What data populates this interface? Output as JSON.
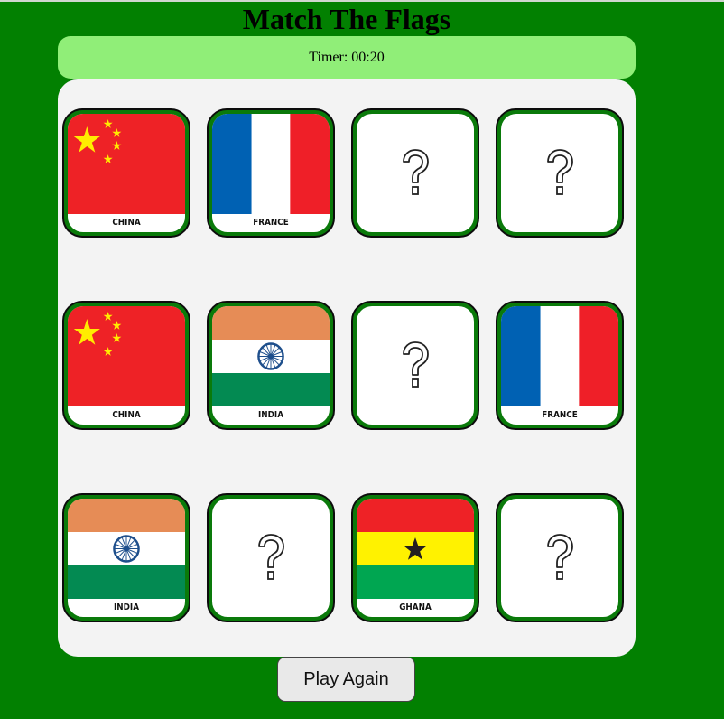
{
  "title": "Match The Flags",
  "timer": "Timer: 00:20",
  "play_again_label": "Play Again",
  "colors": {
    "background": "#028001",
    "timer_bar": "#90ee78",
    "board": "#f3f3f3",
    "card_border": "#0a7a0a"
  },
  "cards": [
    {
      "state": "revealed",
      "country": "CHINA",
      "flag": "china"
    },
    {
      "state": "revealed",
      "country": "FRANCE",
      "flag": "france"
    },
    {
      "state": "hidden",
      "icon": "question-mark-icon"
    },
    {
      "state": "hidden",
      "icon": "question-mark-icon"
    },
    {
      "state": "revealed",
      "country": "CHINA",
      "flag": "china"
    },
    {
      "state": "revealed",
      "country": "INDIA",
      "flag": "india"
    },
    {
      "state": "hidden",
      "icon": "question-mark-icon"
    },
    {
      "state": "revealed",
      "country": "FRANCE",
      "flag": "france"
    },
    {
      "state": "revealed",
      "country": "INDIA",
      "flag": "india"
    },
    {
      "state": "hidden",
      "icon": "question-mark-icon"
    },
    {
      "state": "revealed",
      "country": "GHANA",
      "flag": "ghana"
    },
    {
      "state": "hidden",
      "icon": "question-mark-icon"
    }
  ]
}
